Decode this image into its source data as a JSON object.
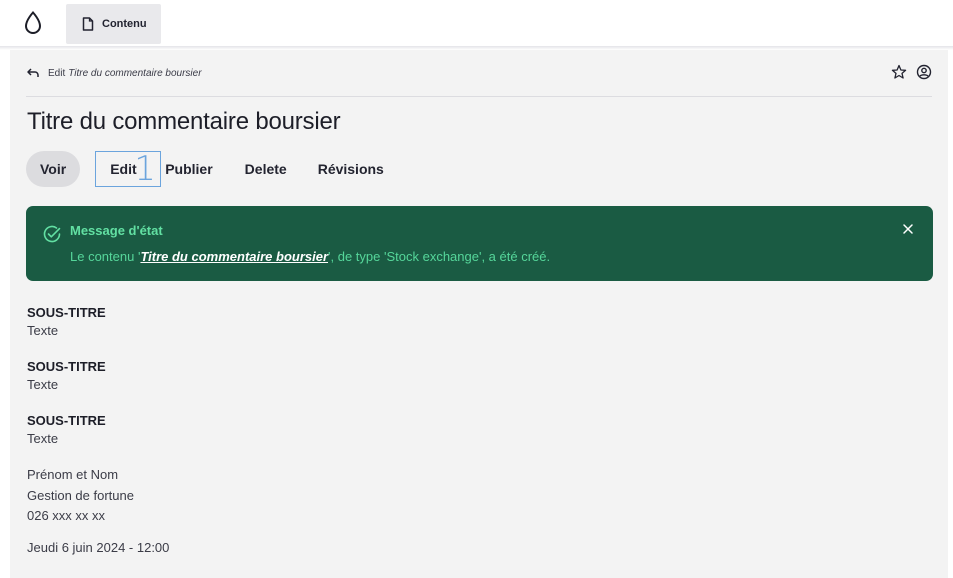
{
  "toolbar": {
    "logo_icon": "drupal-drop-icon",
    "tab_label": "Contenu",
    "tab_icon": "document-icon"
  },
  "breadcrumb": {
    "back_icon": "back-arrow-icon",
    "prefix": "Edit",
    "title": "Titre du commentaire boursier"
  },
  "top_icons": [
    "star-icon",
    "user-circle-icon"
  ],
  "page": {
    "title": "Titre du commentaire boursier"
  },
  "tabs": [
    {
      "label": "Voir",
      "active": true
    },
    {
      "label": "Edit",
      "marker": "1"
    },
    {
      "label": "Publier"
    },
    {
      "label": "Delete"
    },
    {
      "label": "Révisions"
    }
  ],
  "status": {
    "title": "Message d'état",
    "msg_before": "Le contenu '",
    "msg_link": "Titre du commentaire boursier",
    "msg_after": "', de type 'Stock exchange', a été créé.",
    "bg_color": "#1a5b43",
    "accent_color": "#62e0a3"
  },
  "fields": [
    {
      "label": "SOUS-TITRE",
      "value": "Texte"
    },
    {
      "label": "SOUS-TITRE",
      "value": "Texte"
    },
    {
      "label": "SOUS-TITRE",
      "value": "Texte"
    }
  ],
  "contact": {
    "name": "Prénom et Nom",
    "role": "Gestion de fortune",
    "phone": "026 xxx xx xx"
  },
  "date": "Jeudi 6 juin 2024 - 12:00"
}
